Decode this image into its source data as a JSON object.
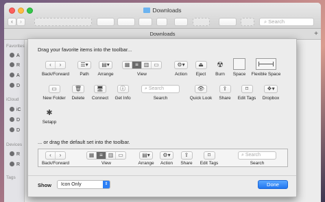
{
  "finder": {
    "title": "Downloads",
    "path_title": "Downloads",
    "search_placeholder": "Search",
    "add_tab": "+",
    "sidebar": {
      "favorites_head": "Favorites",
      "icloud_head": "iCloud",
      "devices_head": "Devices",
      "tags_head": "Tags",
      "items": [
        "A",
        "R",
        "A",
        "D",
        "iC",
        "D",
        "D",
        "R",
        "R"
      ]
    }
  },
  "sheet": {
    "instruction": "Drag your favorite items into the toolbar...",
    "default_instruction": "... or drag the default set into the toolbar.",
    "items": [
      {
        "label": "Back/Forward",
        "icon": "back-forward-icon"
      },
      {
        "label": "Path",
        "icon": "path-icon"
      },
      {
        "label": "Arrange",
        "icon": "arrange-icon"
      },
      {
        "label": "View",
        "icon": "view-icon"
      },
      {
        "label": "Action",
        "icon": "gear-icon"
      },
      {
        "label": "Eject",
        "icon": "eject-icon"
      },
      {
        "label": "Burn",
        "icon": "burn-icon"
      },
      {
        "label": "Space",
        "icon": "space-icon"
      },
      {
        "label": "Flexible Space",
        "icon": "flexible-space-icon"
      },
      {
        "label": "New Folder",
        "icon": "new-folder-icon"
      },
      {
        "label": "Delete",
        "icon": "trash-icon"
      },
      {
        "label": "Connect",
        "icon": "connect-icon"
      },
      {
        "label": "Get Info",
        "icon": "info-icon"
      },
      {
        "label": "Search",
        "icon": "search-icon"
      },
      {
        "label": "Quick Look",
        "icon": "eye-icon"
      },
      {
        "label": "Share",
        "icon": "share-icon"
      },
      {
        "label": "Edit Tags",
        "icon": "tag-icon"
      },
      {
        "label": "Dropbox",
        "icon": "dropbox-icon"
      },
      {
        "label": "Setapp",
        "icon": "setapp-icon"
      }
    ],
    "search_placeholder": "Search",
    "default_items": [
      {
        "label": "Back/Forward"
      },
      {
        "label": "View"
      },
      {
        "label": "Arrange"
      },
      {
        "label": "Action"
      },
      {
        "label": "Share"
      },
      {
        "label": "Edit Tags"
      },
      {
        "label": "Search"
      }
    ],
    "show_label": "Show",
    "show_value": "Icon Only",
    "done_label": "Done"
  },
  "colors": {
    "accent": "#2176f0",
    "selected_segment": "#6a6a6a"
  }
}
